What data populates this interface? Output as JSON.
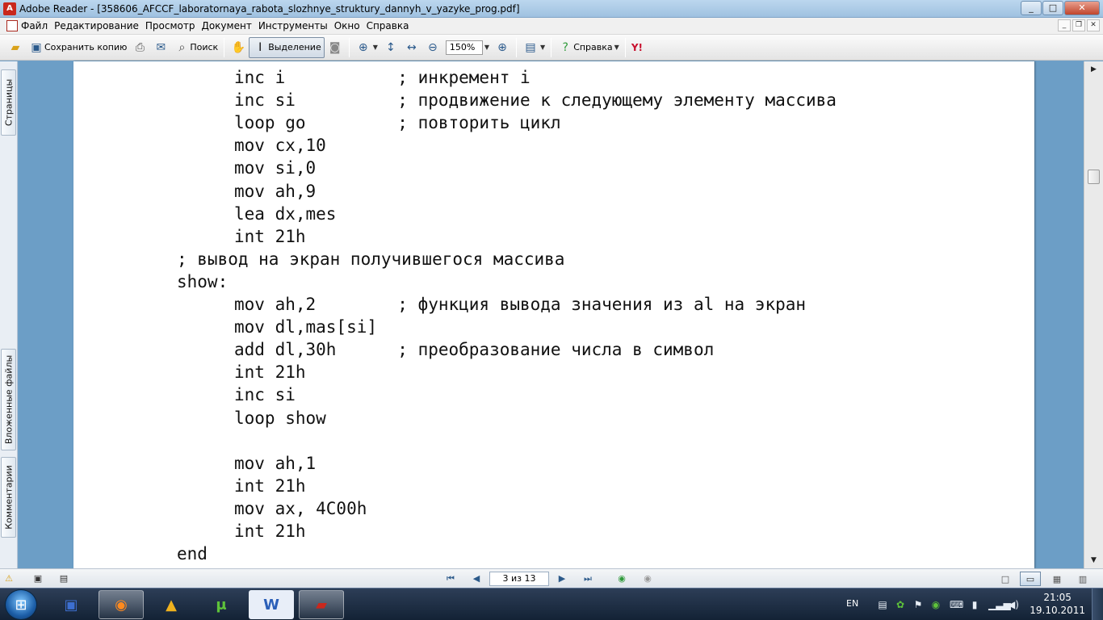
{
  "window": {
    "title": "Adobe Reader - [358606_AFCCF_laboratornaya_rabota_slozhnye_struktury_dannyh_v_yazyke_prog.pdf]"
  },
  "menu": [
    "Файл",
    "Редактирование",
    "Просмотр",
    "Документ",
    "Инструменты",
    "Окно",
    "Справка"
  ],
  "toolbar": {
    "save_copy": "Сохранить копию",
    "search": "Поиск",
    "select": "Выделение",
    "zoom": "150%",
    "help": "Справка",
    "yahoo": "Y!"
  },
  "side_tabs": {
    "pages": "Страницы",
    "attachments": "Вложенные файлы",
    "comments": "Комментарии"
  },
  "document": {
    "lines": [
      {
        "indent": 1,
        "text": "inc i           ; инкремент i"
      },
      {
        "indent": 1,
        "text": "inc si          ; продвижение к следующему элементу массива"
      },
      {
        "indent": 1,
        "text": "loop go         ; повторить цикл"
      },
      {
        "indent": 1,
        "text": "mov cx,10"
      },
      {
        "indent": 1,
        "text": "mov si,0"
      },
      {
        "indent": 1,
        "text": "mov ah,9"
      },
      {
        "indent": 1,
        "text": "lea dx,mes"
      },
      {
        "indent": 1,
        "text": "int 21h"
      },
      {
        "indent": 0,
        "text": "; вывод на экран получившегося массива"
      },
      {
        "indent": 0,
        "text": "show:"
      },
      {
        "indent": 1,
        "text": "mov ah,2        ; функция вывода значения из al на экран"
      },
      {
        "indent": 1,
        "text": "mov dl,mas[si]"
      },
      {
        "indent": 1,
        "text": "add dl,30h      ; преобразование числа в символ"
      },
      {
        "indent": 1,
        "text": "int 21h"
      },
      {
        "indent": 1,
        "text": "inc si"
      },
      {
        "indent": 1,
        "text": "loop show"
      },
      {
        "indent": 1,
        "text": ""
      },
      {
        "indent": 1,
        "text": "mov ah,1"
      },
      {
        "indent": 1,
        "text": "int 21h"
      },
      {
        "indent": 1,
        "text": "mov ax, 4C00h"
      },
      {
        "indent": 1,
        "text": "int 21h"
      },
      {
        "indent": 0,
        "text": "end"
      }
    ]
  },
  "status": {
    "page_indicator": "3 из 13"
  },
  "taskbar": {
    "language": "EN",
    "time": "21:05",
    "date": "19.10.2011",
    "word_label": "W",
    "torrent_label": "μ"
  },
  "colors": {
    "doc_background": "#6c9ec6",
    "page": "#ffffff",
    "acrobat_red": "#c9281d"
  }
}
